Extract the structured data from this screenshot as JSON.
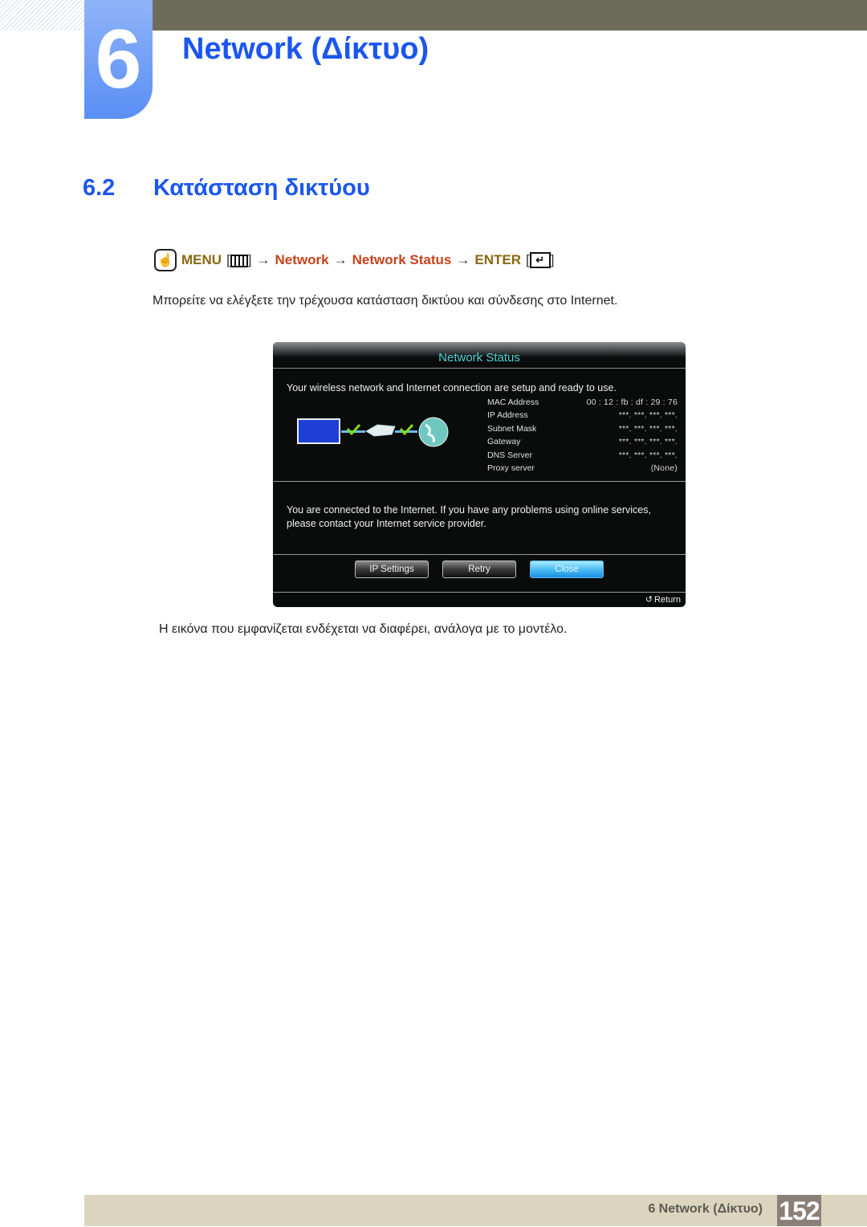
{
  "header": {
    "chapter_number": "6",
    "chapter_title": "Network (Δίκτυο)"
  },
  "section": {
    "number": "6.2",
    "title": "Κατάσταση δικτύου"
  },
  "menu_path": {
    "menu": "MENU",
    "step1": "Network",
    "step2": "Network Status",
    "enter": "ENTER",
    "arrow": "→",
    "icons": [
      "touch-hand-icon",
      "menu-icon",
      "enter-icon"
    ]
  },
  "intro_text": "Μπορείτε να ελέγξετε την τρέχουσα κατάσταση δικτύου και σύνδεσης στο Internet.",
  "tv_screen": {
    "title": "Network Status",
    "status_message": "Your wireless network and Internet connection are setup and ready to use.",
    "info": [
      {
        "label": "MAC Address",
        "value": "00 : 12 : fb : df : 29 : 76"
      },
      {
        "label": "IP Address",
        "value": "***.   ***.   ***.   ***."
      },
      {
        "label": "Subnet Mask",
        "value": "***.   ***.   ***.   ***."
      },
      {
        "label": "Gateway",
        "value": "***.   ***.   ***.   ***."
      },
      {
        "label": "DNS Server",
        "value": "***.   ***.   ***.   ***."
      },
      {
        "label": "Proxy server",
        "value": "(None)"
      }
    ],
    "connection_message": "You are connected to the Internet. If you have any problems using online services, please contact your Internet service provider.",
    "buttons": [
      {
        "label": "IP Settings",
        "active": false
      },
      {
        "label": "Retry",
        "active": false
      },
      {
        "label": "Close",
        "active": true
      }
    ],
    "return_label": "Return",
    "colors": {
      "title": "#4fd4d8",
      "check": "#7fdc1f",
      "active_button": "#47b9f2"
    }
  },
  "note": "Η εικόνα που εμφανίζεται ενδέχεται να διαφέρει, ανάλογα με το μοντέλο.",
  "footer": {
    "label": "6 Network (Δίκτυο)",
    "page_number": "152"
  }
}
